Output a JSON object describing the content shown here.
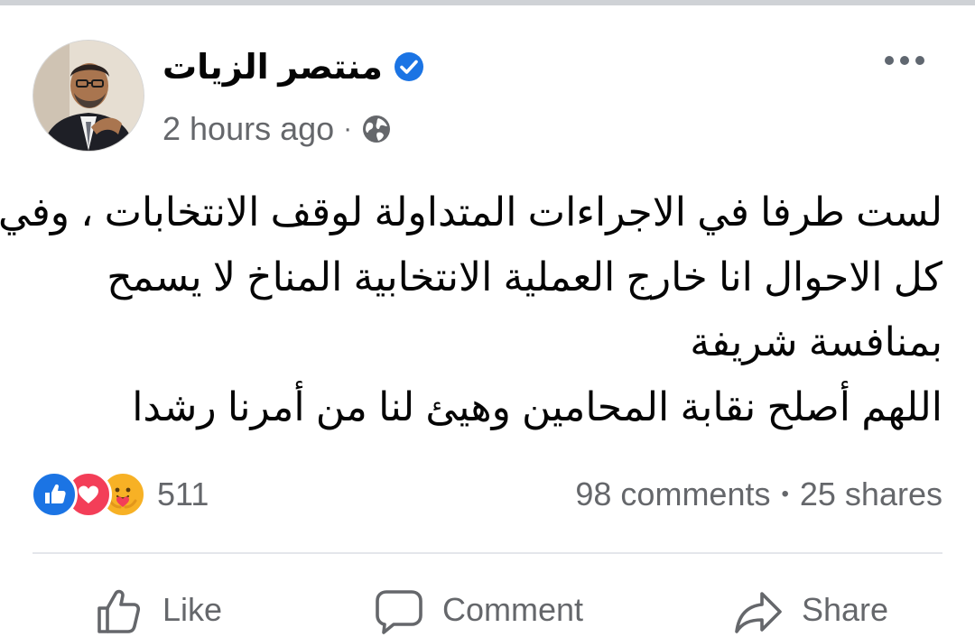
{
  "post": {
    "author_name": "منتصر الزيات",
    "timestamp": "2 hours ago",
    "separator": "·",
    "privacy_icon": "globe-icon",
    "verified_icon": "verified-badge-icon",
    "more_icon": "more-horizontal-icon",
    "text_lines": [
      "لست طرفا في الاجراءات المتداولة لوقف الانتخابات ، وفي",
      "كل الاحوال انا خارج العملية الانتخابية  المناخ لا يسمح",
      "بمنافسة شريفة",
      "اللهم أصلح نقابة المحامين وهيئ لنا من أمرنا رشدا"
    ]
  },
  "engagement": {
    "reaction_icons": [
      "like-reaction-icon",
      "love-reaction-icon",
      "care-reaction-icon"
    ],
    "reaction_count": "511",
    "comments": "98 comments",
    "dot": "•",
    "shares": "25 shares"
  },
  "actions": {
    "like_label": "Like",
    "comment_label": "Comment",
    "share_label": "Share"
  },
  "colors": {
    "brand_blue": "#1b74e4",
    "love_red": "#f33e58",
    "care_yellow": "#f7b125",
    "secondary_text": "#65676b",
    "primary_text": "#050505"
  }
}
